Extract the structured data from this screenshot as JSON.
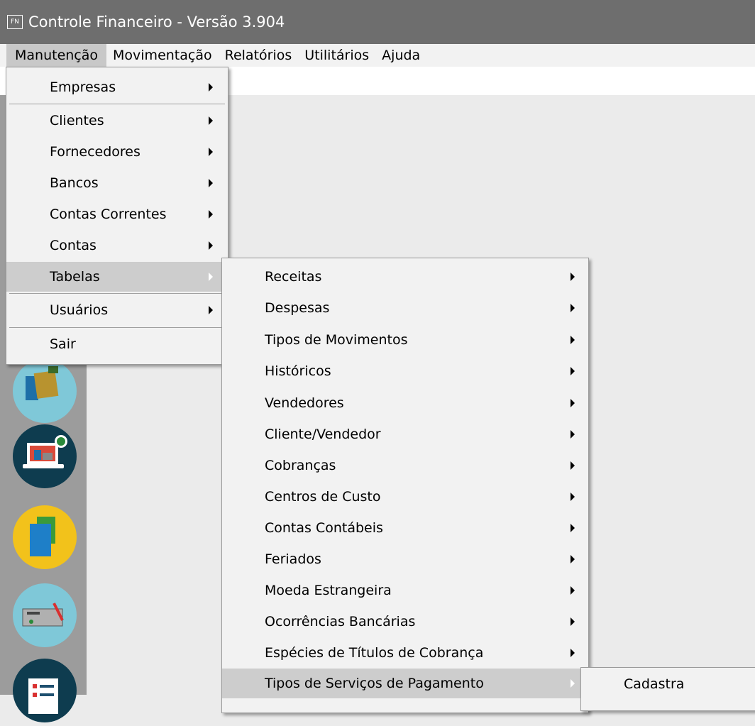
{
  "app": {
    "icon_text": "FN",
    "title": "Controle Financeiro - Versão 3.904"
  },
  "menubar": {
    "items": [
      "Manutenção",
      "Movimentação",
      "Relatórios",
      "Utilitários",
      "Ajuda"
    ]
  },
  "menu_manutencao": {
    "items": [
      {
        "label": "Empresas",
        "submenu": true
      },
      {
        "label": "Clientes",
        "submenu": true
      },
      {
        "label": "Fornecedores",
        "submenu": true
      },
      {
        "label": "Bancos",
        "submenu": true
      },
      {
        "label": "Contas Correntes",
        "submenu": true
      },
      {
        "label": "Contas",
        "submenu": true
      },
      {
        "label": "Tabelas",
        "submenu": true,
        "highlighted": true
      },
      {
        "label": "Usuários",
        "submenu": true
      },
      {
        "label": "Sair",
        "submenu": false
      }
    ]
  },
  "menu_tabelas": {
    "items": [
      {
        "label": "Receitas",
        "submenu": true
      },
      {
        "label": "Despesas",
        "submenu": true
      },
      {
        "label": "Tipos de Movimentos",
        "submenu": true
      },
      {
        "label": "Históricos",
        "submenu": true
      },
      {
        "label": "Vendedores",
        "submenu": true
      },
      {
        "label": "Cliente/Vendedor",
        "submenu": true
      },
      {
        "label": "Cobranças",
        "submenu": true
      },
      {
        "label": "Centros de Custo",
        "submenu": true
      },
      {
        "label": "Contas Contábeis",
        "submenu": true
      },
      {
        "label": "Feriados",
        "submenu": true
      },
      {
        "label": "Moeda Estrangeira",
        "submenu": true
      },
      {
        "label": "Ocorrências Bancárias",
        "submenu": true
      },
      {
        "label": "Espécies de Títulos de Cobrança",
        "submenu": true
      },
      {
        "label": "Tipos de Serviços de Pagamento",
        "submenu": true,
        "highlighted": true
      }
    ]
  },
  "menu_tipos_servicos": {
    "items": [
      {
        "label": "Cadastra"
      }
    ]
  },
  "sidebar_icons": [
    "wallet-icon",
    "laptop-dollar-icon",
    "documents-icon",
    "check-signature-icon",
    "checklist-icon"
  ],
  "colors": {
    "titlebar": "#6e6e6e",
    "menu_bg": "#f2f2f2",
    "highlight": "#cdcdcd",
    "icon_column": "#9c9c9c"
  }
}
